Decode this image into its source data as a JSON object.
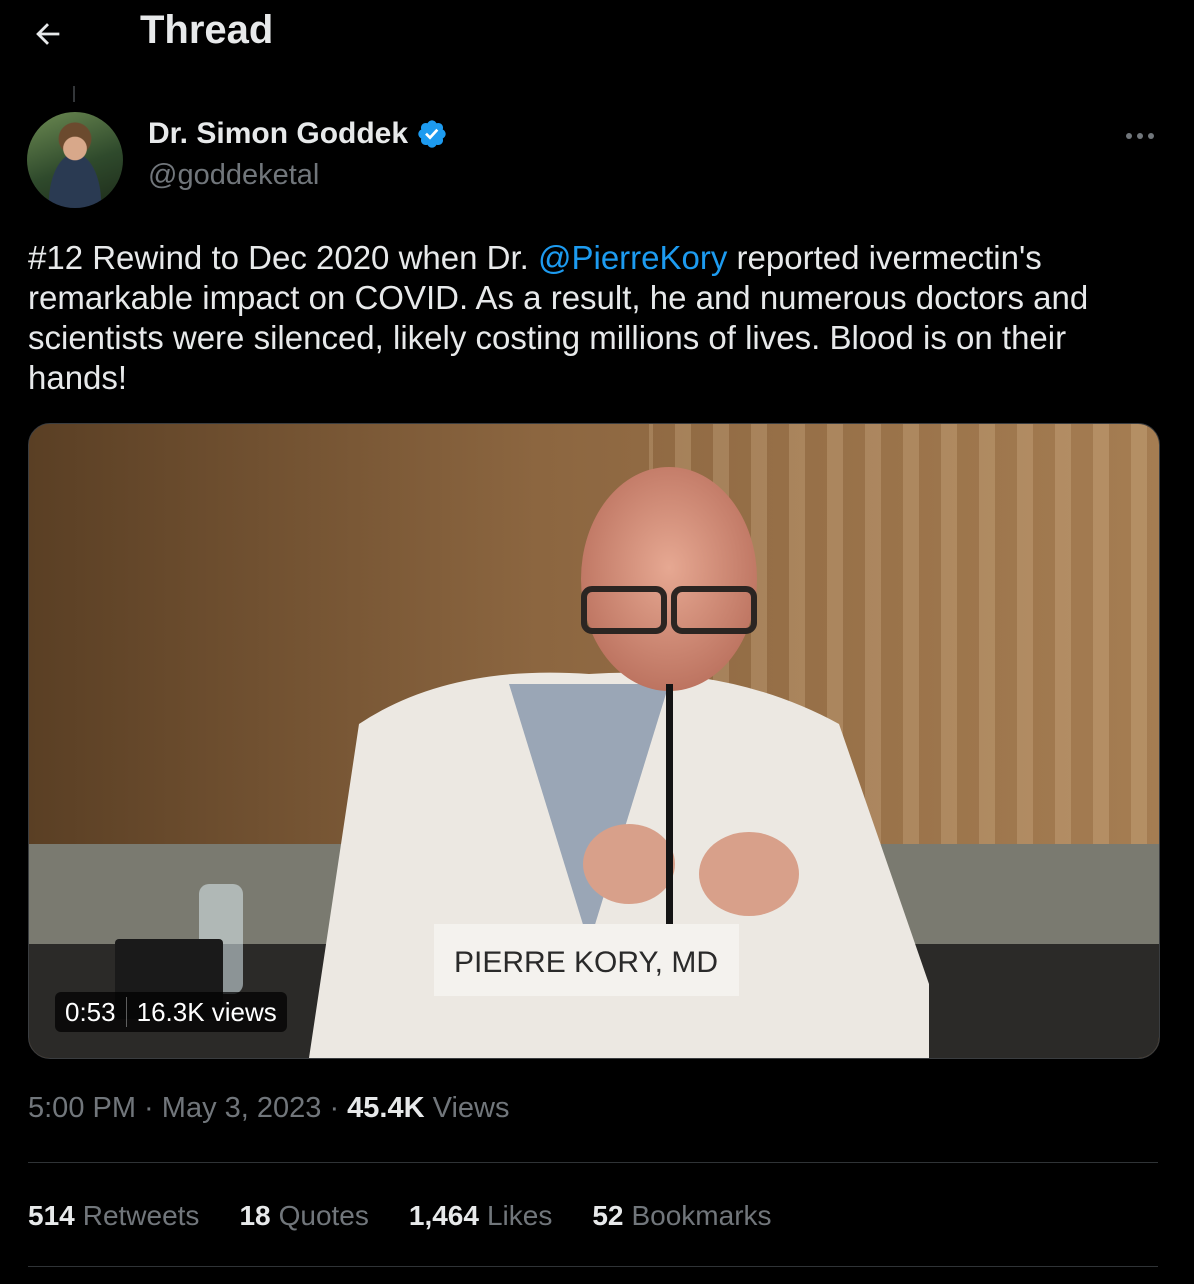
{
  "header": {
    "title": "Thread"
  },
  "author": {
    "display_name": "Dr. Simon Goddek",
    "handle": "@goddeketal"
  },
  "tweet": {
    "text_before": "#12 Rewind to Dec 2020 when Dr. ",
    "mention": "@PierreKory",
    "text_after": " reported ivermectin's remarkable impact on COVID. As a result, he and numerous doctors and scientists were silenced, likely costing millions of lives. Blood is on their hands!"
  },
  "media": {
    "nameplate": "PIERRE KORY, MD",
    "duration": "0:53",
    "views": "16.3K views"
  },
  "meta": {
    "time": "5:00 PM",
    "sep1": " · ",
    "date": "May 3, 2023",
    "sep2": " · ",
    "views_count": "45.4K",
    "views_label": " Views"
  },
  "stats": [
    {
      "count": "514",
      "label": "Retweets"
    },
    {
      "count": "18",
      "label": "Quotes"
    },
    {
      "count": "1,464",
      "label": "Likes"
    },
    {
      "count": "52",
      "label": "Bookmarks"
    }
  ],
  "colors": {
    "accent": "#1d9bf0",
    "background": "#000000",
    "text": "#e7e9ea",
    "secondary": "#71767b"
  },
  "icons": {
    "back": "arrow-left-icon",
    "verified": "verified-badge-icon",
    "more": "more-horizontal-icon"
  }
}
